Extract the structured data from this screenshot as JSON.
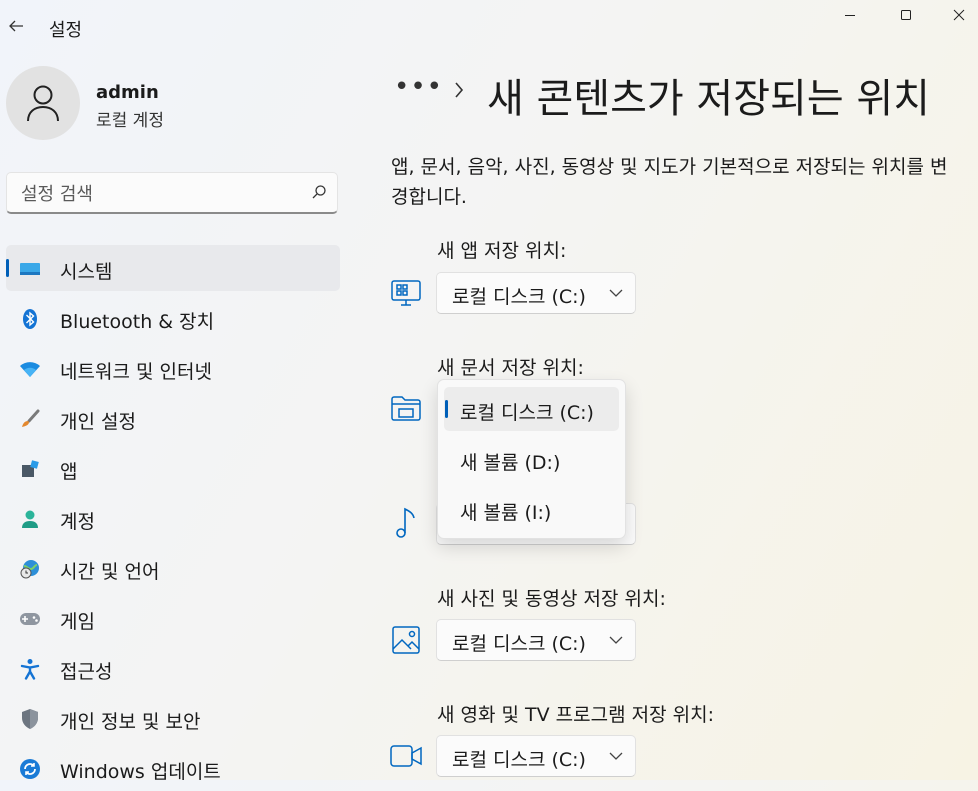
{
  "window": {
    "title": "설정"
  },
  "user": {
    "name": "admin",
    "account_type": "로컬 계정"
  },
  "search": {
    "placeholder": "설정 검색"
  },
  "nav": [
    {
      "label": "시스템",
      "icon": "system-icon",
      "selected": true
    },
    {
      "label": "Bluetooth & 장치",
      "icon": "bluetooth-icon"
    },
    {
      "label": "네트워크 및 인터넷",
      "icon": "wifi-icon"
    },
    {
      "label": "개인 설정",
      "icon": "brush-icon"
    },
    {
      "label": "앱",
      "icon": "apps-icon"
    },
    {
      "label": "계정",
      "icon": "account-icon"
    },
    {
      "label": "시간 및 언어",
      "icon": "globe-clock-icon"
    },
    {
      "label": "게임",
      "icon": "gamepad-icon"
    },
    {
      "label": "접근성",
      "icon": "accessibility-icon"
    },
    {
      "label": "개인 정보 및 보안",
      "icon": "shield-icon"
    },
    {
      "label": "Windows 업데이트",
      "icon": "update-icon"
    }
  ],
  "breadcrumb": {
    "overflow": "•••",
    "title": "새 콘텐츠가 저장되는 위치"
  },
  "description": "앱, 문서, 음악, 사진, 동영상 및 지도가 기본적으로 저장되는 위치를 변경합니다.",
  "sections": [
    {
      "label": "새 앱 저장 위치:",
      "value": "로컬 디스크 (C:)",
      "icon": "monitor-apps-icon"
    },
    {
      "label": "새 문서 저장 위치:",
      "value": "로컬 디스크 (C:)",
      "icon": "folder-icon"
    },
    {
      "label": "",
      "value": "",
      "icon": "music-note-icon"
    },
    {
      "label": "새 사진 및 동영상 저장 위치:",
      "value": "로컬 디스크 (C:)",
      "icon": "picture-icon"
    },
    {
      "label": "새 영화 및 TV 프로그램 저장 위치:",
      "value": "로컬 디스크 (C:)",
      "icon": "video-camera-icon"
    }
  ],
  "dropdown": {
    "options": [
      {
        "label": "로컬 디스크 (C:)",
        "selected": true
      },
      {
        "label": "새 볼륨 (D:)"
      },
      {
        "label": "새 볼륨 (I:)"
      }
    ]
  },
  "colors": {
    "accent": "#005fb8",
    "icon_blue": "#0067c0"
  }
}
